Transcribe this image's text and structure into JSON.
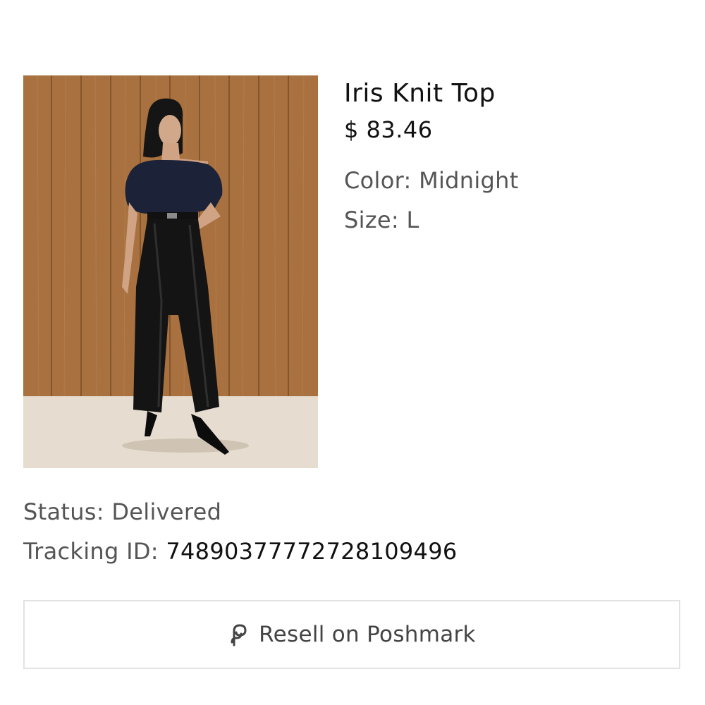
{
  "product": {
    "image_alt": "Model wearing navy off-shoulder knit top and black leather wide-leg pants",
    "name": "Iris Knit Top",
    "price": "$ 83.46",
    "color_label": "Color:",
    "color_value": "Midnight",
    "size_label": "Size:",
    "size_value": "L"
  },
  "order": {
    "status_label": "Status:",
    "status_value": "Delivered",
    "tracking_label": "Tracking ID:",
    "tracking_value": "748903777727281094 96"
  },
  "actions": {
    "resell_icon": "poshmark-icon",
    "resell_label": "Resell on Poshmark"
  },
  "colors": {
    "text_primary": "#111111",
    "text_secondary": "#555555",
    "button_border": "#e2e2e2"
  }
}
